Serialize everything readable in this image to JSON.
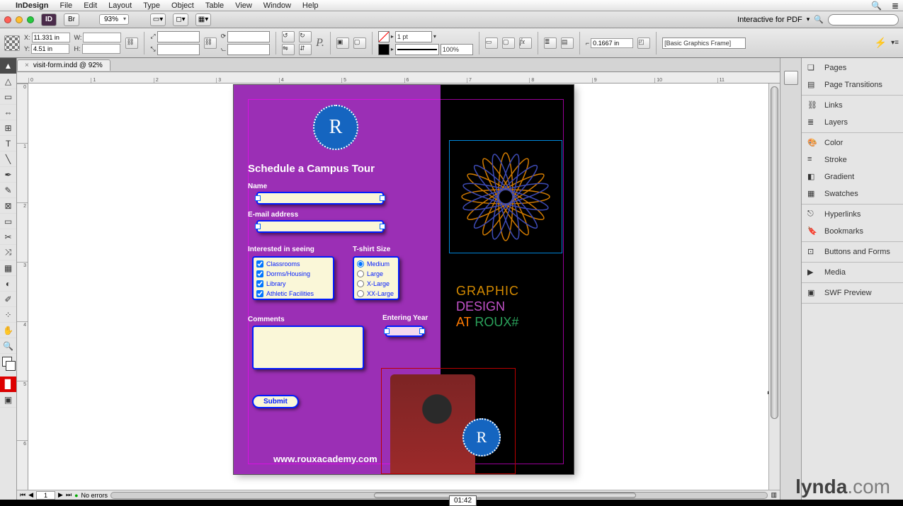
{
  "menubar": {
    "app": "InDesign",
    "items": [
      "File",
      "Edit",
      "Layout",
      "Type",
      "Object",
      "Table",
      "View",
      "Window",
      "Help"
    ]
  },
  "appbar": {
    "zoom": "93%",
    "workspace": "Interactive for PDF",
    "search_placeholder": ""
  },
  "control": {
    "x": "11.331 in",
    "y": "4.51 in",
    "w": "",
    "h": "",
    "stroke": "1 pt",
    "hval": "0.1667 in",
    "opacity": "100%",
    "style": "[Basic Graphics Frame]"
  },
  "document": {
    "tab": "visit-form.indd @ 92%"
  },
  "ruler_h": [
    "0",
    "1",
    "2",
    "3",
    "4",
    "5",
    "6",
    "7",
    "8",
    "9",
    "10",
    "11"
  ],
  "ruler_v": [
    "0",
    "1",
    "2",
    "3",
    "4",
    "5",
    "6"
  ],
  "page": {
    "logo": "R",
    "logo_sm": "R",
    "title": "Schedule a Campus Tour",
    "labels": {
      "name": "Name",
      "email": "E-mail address",
      "interested": "Interested in seeing",
      "tshirt": "T-shirt Size",
      "comments": "Comments",
      "year": "Entering Year"
    },
    "interested_opts": [
      "Classrooms",
      "Dorms/Housing",
      "Library",
      "Athletic Facilities"
    ],
    "tshirt_opts": [
      "Medium",
      "Large",
      "X-Large",
      "XX-Large"
    ],
    "submit": "Submit",
    "url": "www.rouxacademy.com",
    "gdr": {
      "l1": "GRAPHIC",
      "l2": "DESIGN",
      "l3a": "AT ",
      "l3b": "ROUX#"
    }
  },
  "footer": {
    "page": "1",
    "preflight": "No errors"
  },
  "panels": [
    "Pages",
    "Page Transitions",
    "Links",
    "Layers",
    "Color",
    "Stroke",
    "Gradient",
    "Swatches",
    "Hyperlinks",
    "Bookmarks",
    "Buttons and Forms",
    "Media",
    "SWF Preview"
  ],
  "watermark": {
    "bold": "lynda",
    "rest": ".com"
  },
  "timecode": "01:42"
}
